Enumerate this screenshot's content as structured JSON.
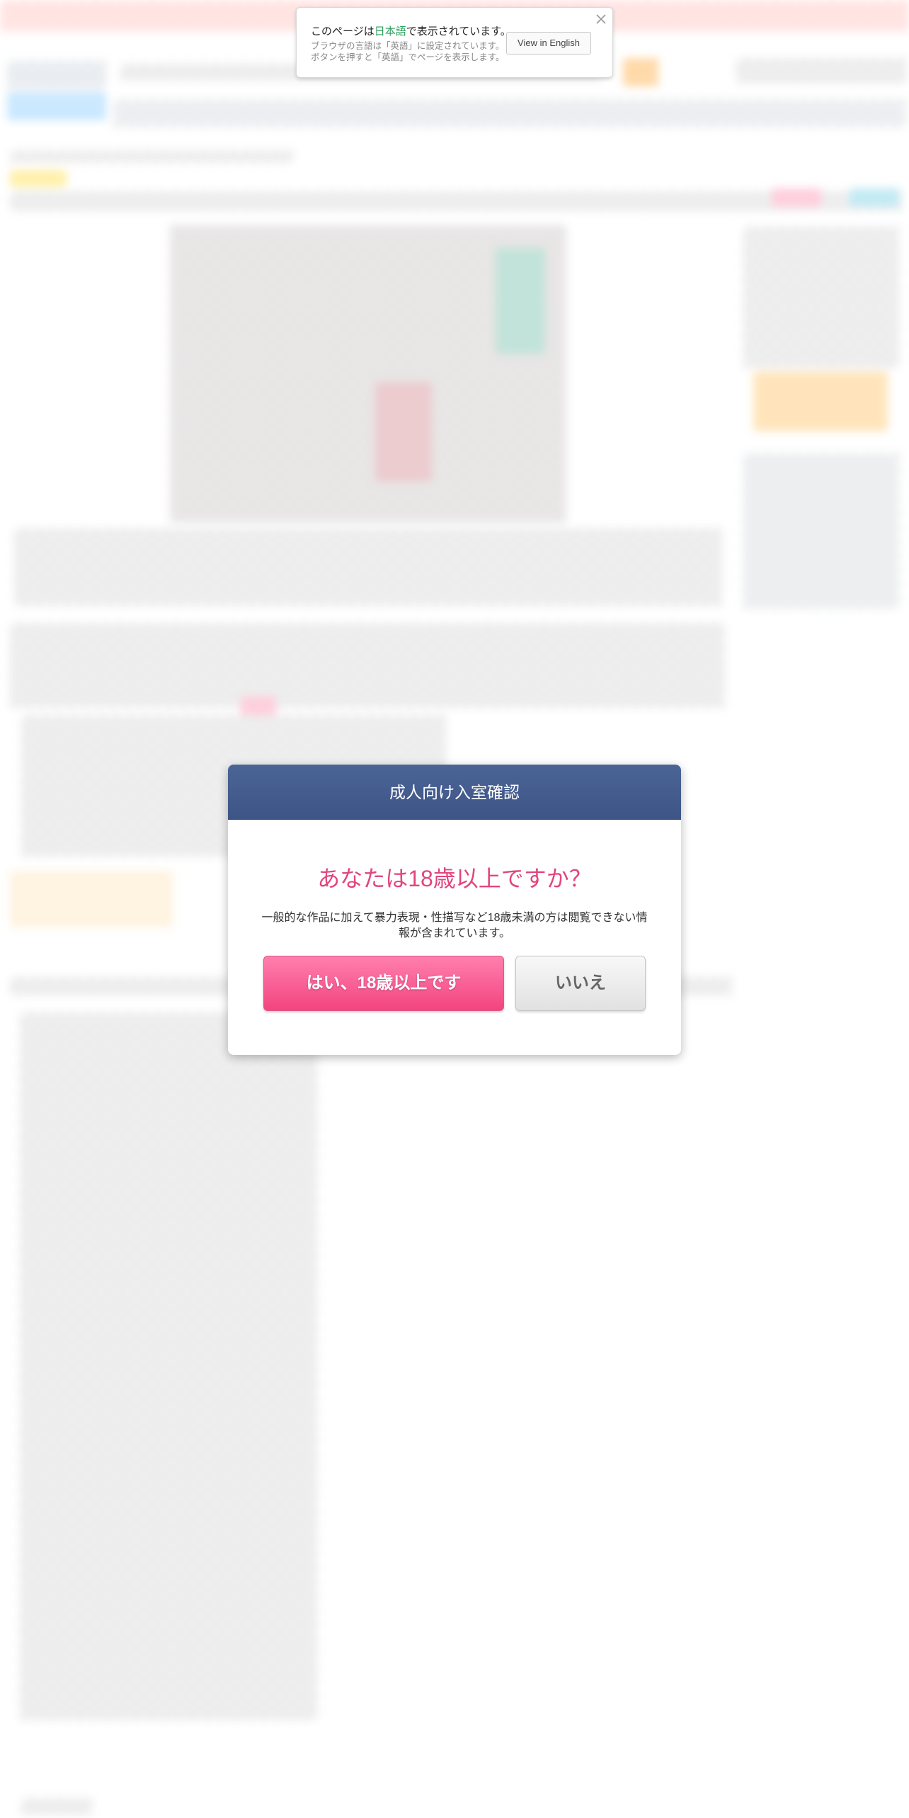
{
  "language_banner": {
    "message_prefix": "このページは",
    "message_language": "日本語",
    "message_suffix": "で表示されています。",
    "sub_line_1": "ブラウザの言語は「英語」に設定されています。",
    "sub_line_2": "ボタンを押すと「英語」でページを表示します。",
    "view_button": "View in English",
    "close_icon": "close-icon",
    "highlight_color": "#2aa05a"
  },
  "age_modal": {
    "title": "成人向け入室確認",
    "question": "あなたは18歳以上ですか？",
    "description": "一般的な作品に加えて暴力表現・性描写など18歳未満の方は閲覧できない情報が含まれています。",
    "yes_button": "はい、18歳以上です",
    "no_button": "いいえ",
    "header_color": "#425a8c",
    "question_color": "#e2457e",
    "yes_color": "#f3447f"
  }
}
